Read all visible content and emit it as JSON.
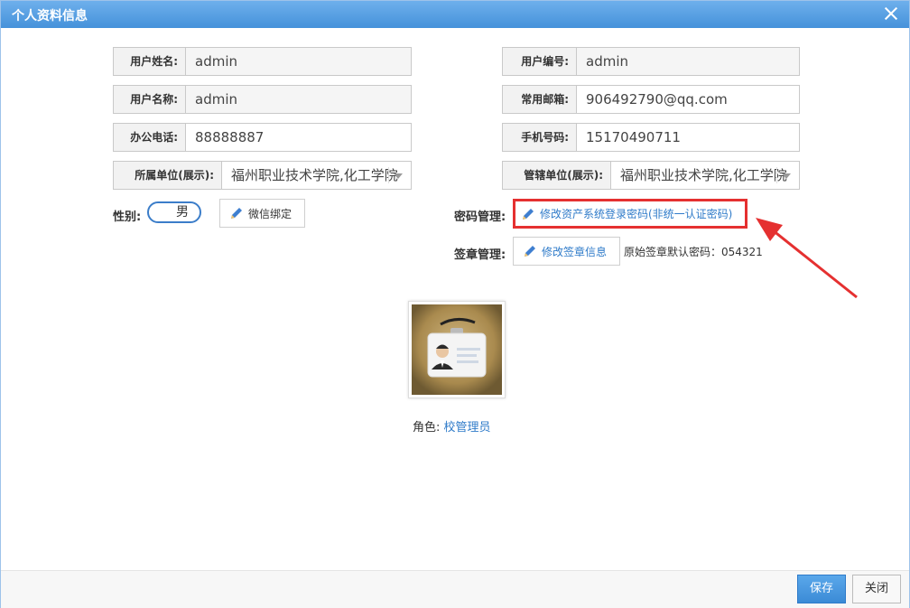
{
  "window": {
    "title": "个人资料信息"
  },
  "fields": {
    "user_fullname": {
      "label": "用户姓名:",
      "value": "admin"
    },
    "user_id": {
      "label": "用户编号:",
      "value": "admin"
    },
    "user_name": {
      "label": "用户名称:",
      "value": "admin"
    },
    "email": {
      "label": "常用邮箱:",
      "value": "906492790@qq.com"
    },
    "office_phone": {
      "label": "办公电话:",
      "value": "88888887"
    },
    "mobile": {
      "label": "手机号码:",
      "value": "15170490711"
    },
    "dept": {
      "label": "所属单位(展示):",
      "value": "福州职业技术学院,化工学院"
    },
    "managed_dept": {
      "label": "管辖单位(展示):",
      "value": "福州职业技术学院,化工学院"
    }
  },
  "gender": {
    "label": "性别:",
    "value": "男"
  },
  "wechat_button": "微信绑定",
  "password": {
    "label": "密码管理:",
    "button": "修改资产系统登录密码(非统一认证密码)"
  },
  "signature": {
    "label": "签章管理:",
    "button": "修改签章信息",
    "hint": "原始签章默认密码：054321"
  },
  "role": {
    "label": "角色:",
    "value": "校管理员"
  },
  "footer": {
    "save": "保存",
    "close": "关闭"
  },
  "colors": {
    "accent": "#3b8bd6",
    "highlight": "#e53030",
    "link": "#2f7bc9"
  }
}
